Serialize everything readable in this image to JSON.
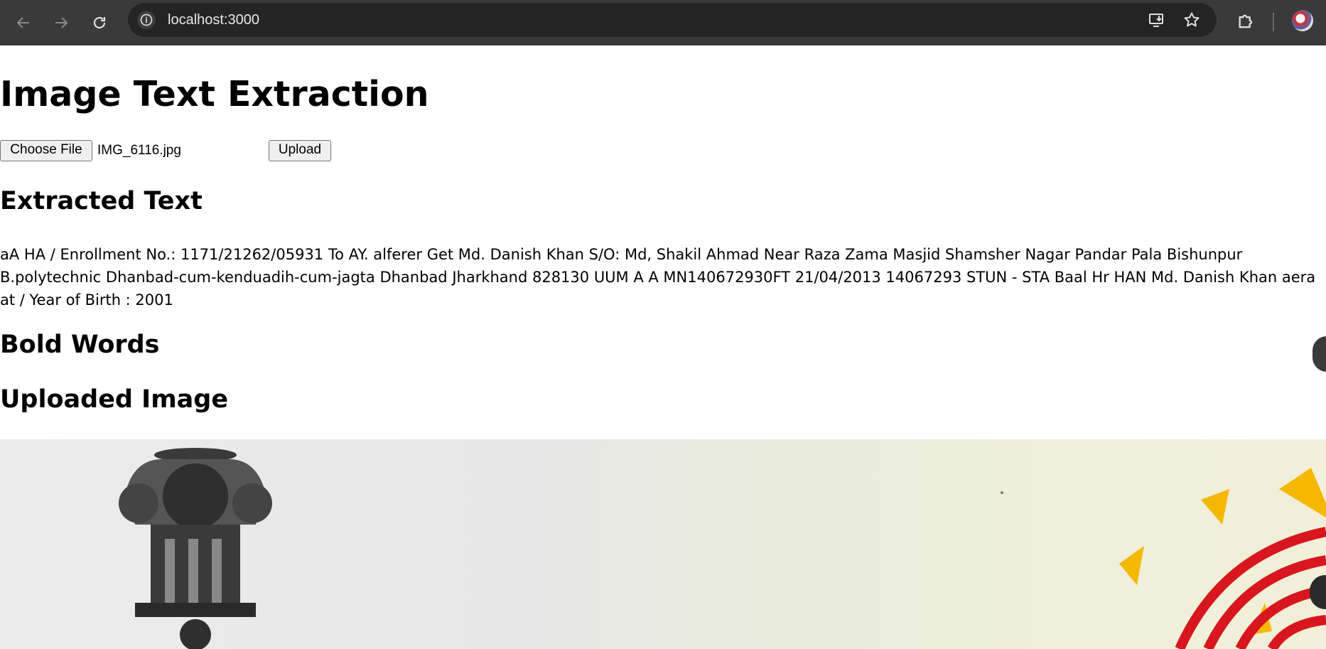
{
  "browser": {
    "url": "localhost:3000",
    "icons": {
      "back": "arrow-left-icon",
      "forward": "arrow-right-icon",
      "reload": "reload-icon",
      "site_info": "info-icon",
      "install": "install-app-icon",
      "bookmark": "star-icon",
      "extensions": "puzzle-icon",
      "profile": "avatar"
    }
  },
  "page": {
    "title": "Image Text Extraction",
    "file_input": {
      "button_label": "Choose File",
      "file_name": "IMG_6116.jpg"
    },
    "upload_label": "Upload",
    "extracted_heading": "Extracted Text",
    "extracted_text": "aA HA / Enrollment No.: 1171/21262/05931 To AY. alferer Get Md. Danish Khan S/O: Md, Shakil Ahmad Near Raza Zama Masjid Shamsher Nagar Pandar Pala Bishunpur\nB.polytechnic Dhanbad-cum-kenduadih-cum-jagta Dhanbad Jharkhand 828130 UUM A A MN140672930FT 21/04/2013 14067293 STUN - STA Baal Hr HAN Md. Danish Khan aera\nat / Year of Birth : 2001",
    "bold_heading": "Bold Words",
    "uploaded_heading": "Uploaded Image"
  },
  "colors": {
    "chrome_bg": "#3a3a3a",
    "omnibox_bg": "#242424",
    "page_bg": "#ffffff",
    "emblem_grey": "#2f2f2f",
    "sun_yellow": "#f5b800",
    "fingerprint_red": "#d8161e"
  }
}
